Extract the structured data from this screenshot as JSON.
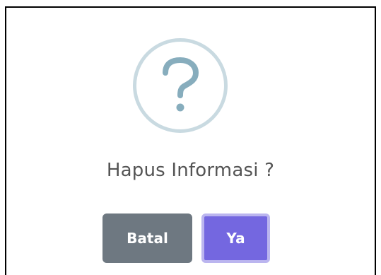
{
  "dialog": {
    "icon": "question-mark-icon",
    "title": "Hapus Informasi ?",
    "cancel_label": "Batal",
    "confirm_label": "Ya"
  },
  "colors": {
    "icon_ring": "#c9dae1",
    "icon_glyph": "#87adbd",
    "title_text": "#545454",
    "cancel_bg": "#6e7881",
    "confirm_bg": "#7467e0",
    "confirm_focus_ring": "#bbb5ef"
  }
}
